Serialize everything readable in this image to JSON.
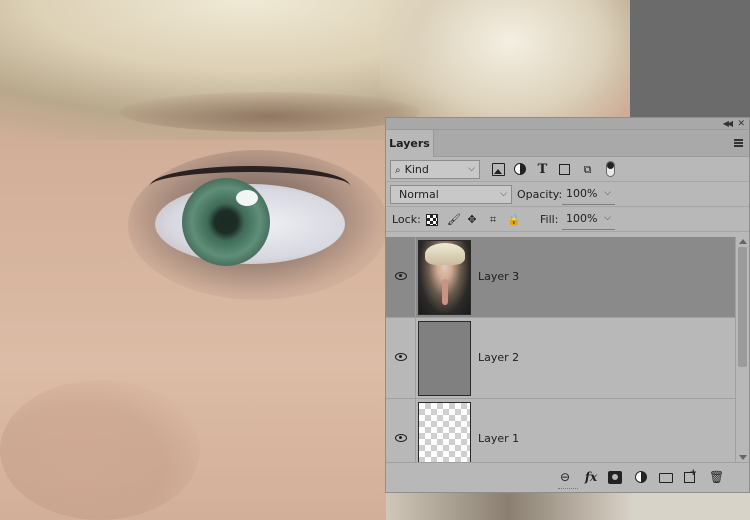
{
  "panel": {
    "tab_label": "Layers",
    "filter": {
      "kind_value": "Kind",
      "icons": [
        "image-filter-icon",
        "adjustment-filter-icon",
        "type-filter-icon",
        "shape-filter-icon",
        "smart-object-filter-icon",
        "filter-toggle-icon"
      ]
    },
    "blend_mode": "Normal",
    "opacity_label": "Opacity:",
    "opacity_value": "100%",
    "lock_label": "Lock:",
    "fill_label": "Fill:",
    "fill_value": "100%",
    "lock_icons": [
      "lock-transparent-pixels-icon",
      "lock-image-pixels-icon",
      "lock-position-icon",
      "lock-artboard-icon",
      "lock-all-icon"
    ],
    "layers": [
      {
        "name": "Layer 3",
        "thumbnail": "photo",
        "visible": true,
        "selected": true
      },
      {
        "name": "Layer 2",
        "thumbnail": "gray",
        "visible": true,
        "selected": false
      },
      {
        "name": "Layer 1",
        "thumbnail": "transparent",
        "visible": true,
        "selected": false
      }
    ],
    "footer_icons": [
      "link-layers-icon",
      "fx-icon",
      "add-mask-icon",
      "adjustment-layer-icon",
      "new-group-icon",
      "new-layer-icon",
      "delete-layer-icon"
    ]
  },
  "colors": {
    "panel_bg": "#b8b8b8",
    "selected_layer_bg": "#8a8a8a",
    "workspace_bg": "#6b6b6b"
  }
}
